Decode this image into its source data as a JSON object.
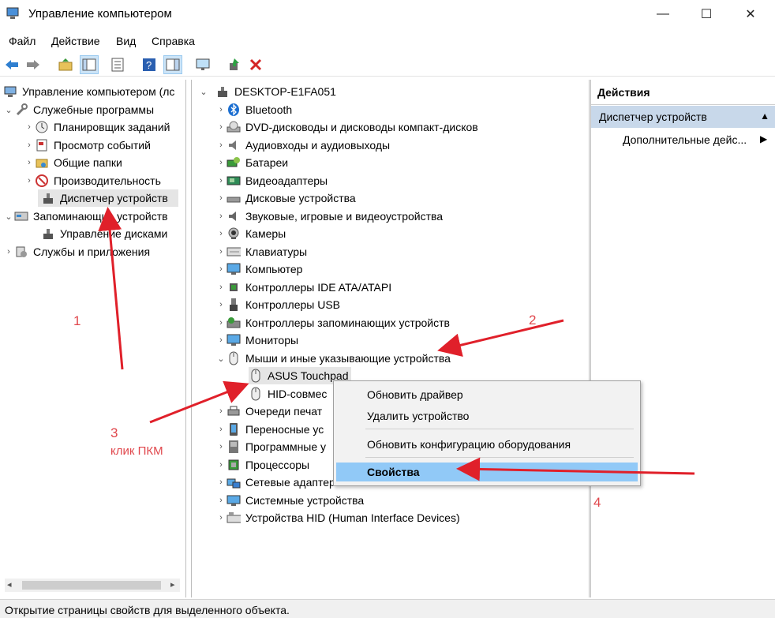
{
  "window": {
    "title": "Управление компьютером",
    "minimize": "—",
    "maximize": "☐",
    "close": "✕"
  },
  "menu": [
    "Файл",
    "Действие",
    "Вид",
    "Справка"
  ],
  "left_tree": {
    "root": "Управление компьютером (лс",
    "utilities": "Служебные программы",
    "scheduler": "Планировщик заданий",
    "events": "Просмотр событий",
    "shared": "Общие папки",
    "perf": "Производительность",
    "devmgr": "Диспетчер устройств",
    "storage": "Запоминающие устройств",
    "disks": "Управление дисками",
    "services": "Службы и приложения"
  },
  "device_tree": {
    "computer": "DESKTOP-E1FA051",
    "categories": [
      "Bluetooth",
      "DVD-дисководы и дисководы компакт-дисков",
      "Аудиовходы и аудиовыходы",
      "Батареи",
      "Видеоадаптеры",
      "Дисковые устройства",
      "Звуковые, игровые и видеоустройства",
      "Камеры",
      "Клавиатуры",
      "Компьютер",
      "Контроллеры IDE ATA/ATAPI",
      "Контроллеры USB",
      "Контроллеры запоминающих устройств",
      "Мониторы",
      "Мыши и иные указывающие устройства"
    ],
    "mice_children": [
      "ASUS Touchpad",
      "HID-совмес"
    ],
    "categories_after": [
      "Очереди печат",
      "Переносные ус",
      "Программные у",
      "Процессоры",
      "Сетевые адаптеры",
      "Системные устройства",
      "Устройства HID (Human Interface Devices)"
    ]
  },
  "context_menu": {
    "update_driver": "Обновить драйвер",
    "remove_device": "Удалить устройство",
    "scan_hardware": "Обновить конфигурацию оборудования",
    "properties": "Свойства"
  },
  "actions": {
    "header": "Действия",
    "group": "Диспетчер устройств",
    "more": "Дополнительные дейс..."
  },
  "status": "Открытие страницы свойств для выделенного объекта.",
  "annotations": {
    "n1": "1",
    "n2": "2",
    "n3": "3",
    "n3_text": "клик ПКМ",
    "n4": "4"
  },
  "colors": {
    "arrow": "#e0202a",
    "context_highlight": "#91c9f7",
    "actions_group": "#c8d8ea"
  }
}
